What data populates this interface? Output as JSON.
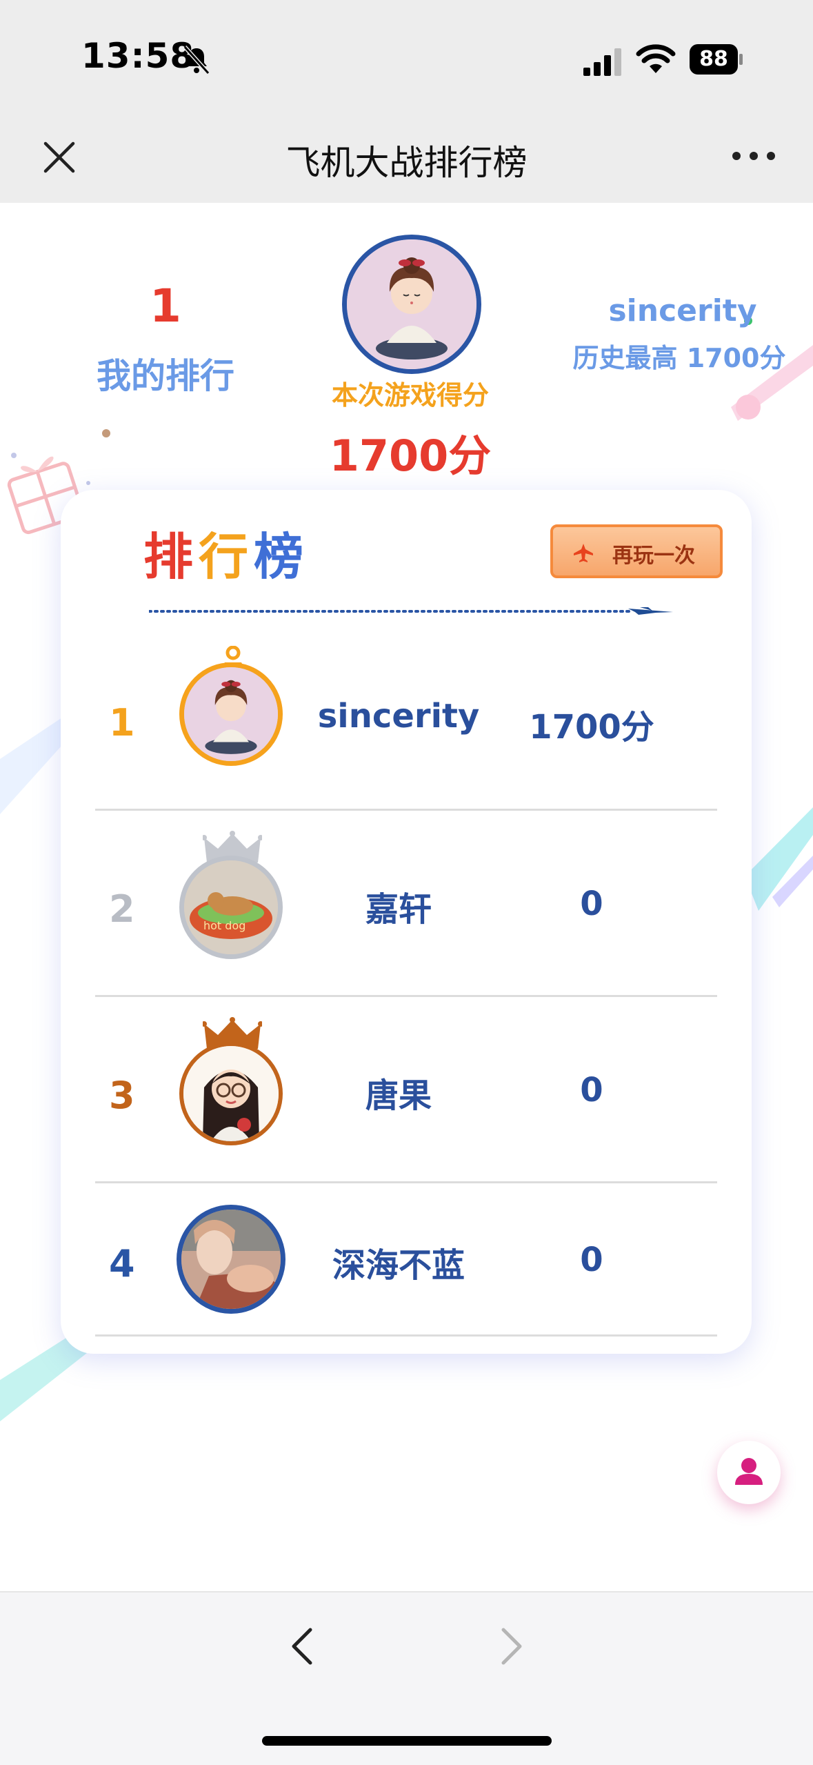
{
  "status_bar": {
    "time": "13:58",
    "battery": "88"
  },
  "nav": {
    "title": "飞机大战排行榜"
  },
  "header": {
    "my_rank": "1",
    "my_rank_label": "我的排行",
    "score_label": "本次游戏得分",
    "score_value": "1700分",
    "best_name": "sincerity",
    "best_line": "历史最高 1700分"
  },
  "board": {
    "title_chars": [
      "排",
      "行",
      "榜"
    ],
    "replay_label": "再玩一次",
    "rows": [
      {
        "rank": "1",
        "name": "sincerity",
        "score": "1700分",
        "rank_color": "#f4a21d",
        "ring_color": "#f6a21c"
      },
      {
        "rank": "2",
        "name": "嘉轩",
        "score": "0",
        "rank_color": "#b8bcc4",
        "ring_color": "#bfc3cb"
      },
      {
        "rank": "3",
        "name": "唐果",
        "score": "0",
        "rank_color": "#c2641b",
        "ring_color": "#c2641b"
      },
      {
        "rank": "4",
        "name": "深海不蓝",
        "score": "0",
        "rank_color": "#2a55a5",
        "ring_color": "#2a55a5"
      }
    ]
  },
  "icons": {
    "close": "close-icon",
    "more": "more-icon",
    "bell_muted": "bell-slash-icon",
    "replay": "plane-icon",
    "user": "user-icon",
    "back": "chevron-left-icon",
    "forward": "chevron-right-icon"
  },
  "colors": {
    "accent_red": "#e63b2e",
    "accent_orange": "#f4a21d",
    "accent_blue": "#2a4f9c",
    "light_blue": "#6a9ae6"
  }
}
